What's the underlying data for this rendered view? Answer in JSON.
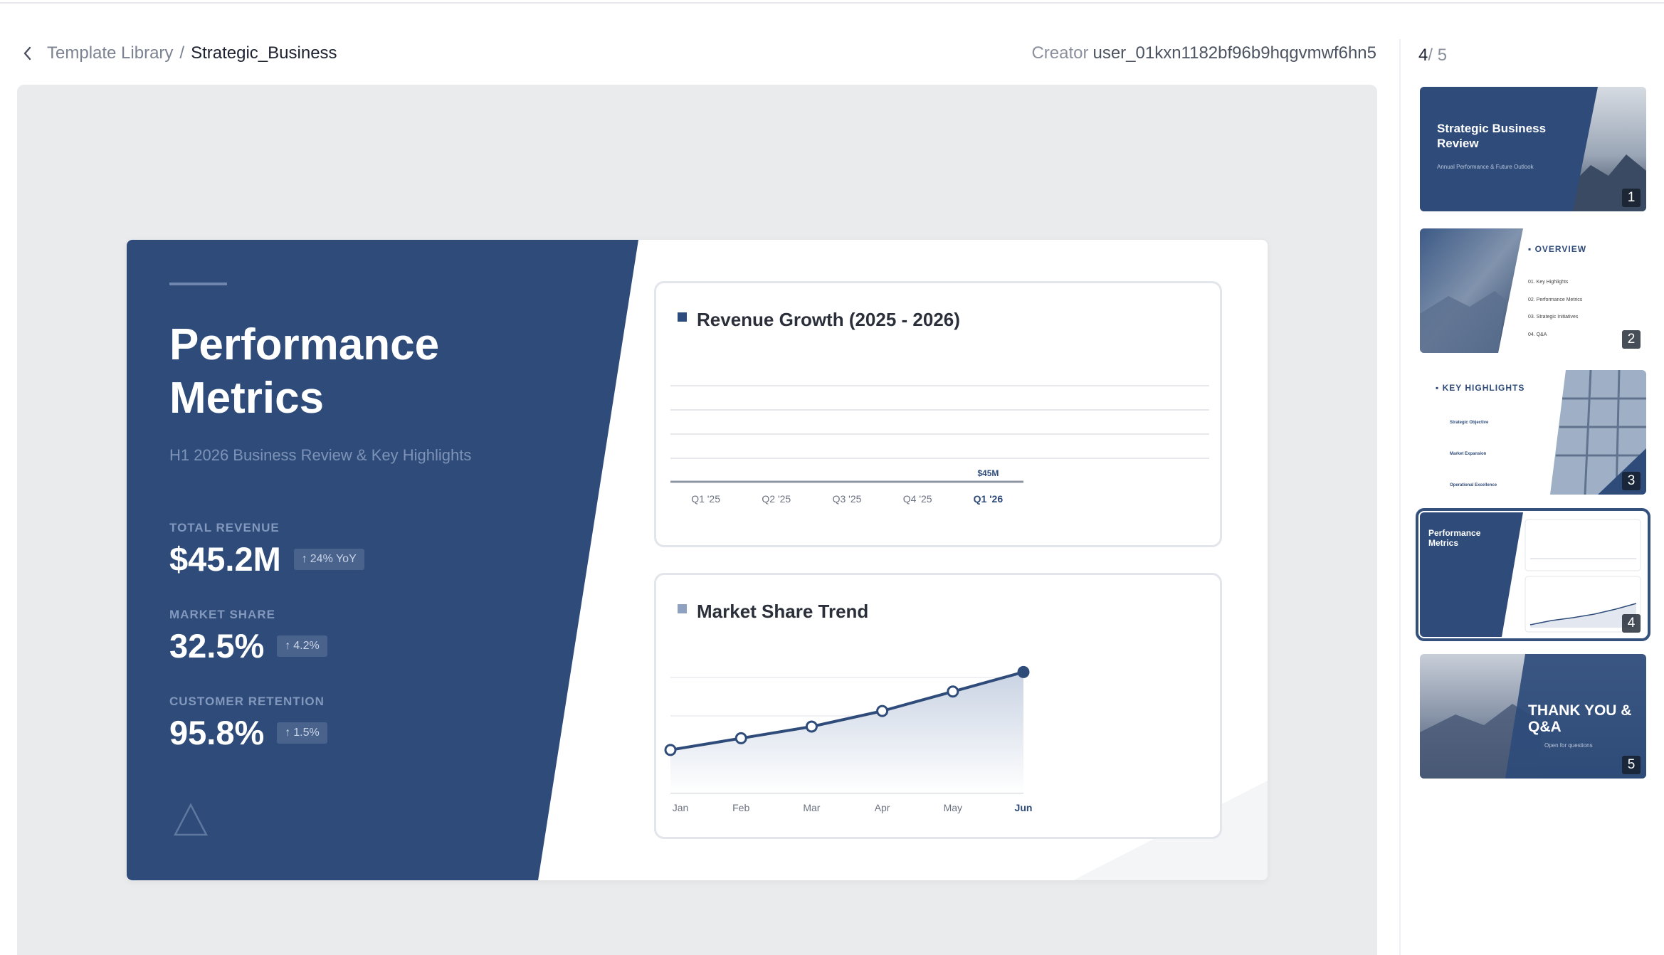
{
  "breadcrumb": {
    "parent": "Template Library",
    "separator": "/",
    "current": "Strategic_Business"
  },
  "creator": {
    "label": "Creator",
    "name": "user_01kxn1182bf96b9hqgvmwf6hn5"
  },
  "slide": {
    "title_line1": "Performance",
    "title_line2": "Metrics",
    "subtitle": "H1 2026 Business Review & Key Highlights",
    "metrics": [
      {
        "label": "TOTAL REVENUE",
        "value": "$45.2M",
        "badge": "24% YoY"
      },
      {
        "label": "MARKET SHARE",
        "value": "32.5%",
        "badge": "4.2%"
      },
      {
        "label": "CUSTOMER RETENTION",
        "value": "95.8%",
        "badge": "1.5%"
      }
    ]
  },
  "chart_data": [
    {
      "type": "bar",
      "title": "Revenue Growth (2025 - 2026)",
      "categories": [
        "Q1 '25",
        "Q2 '25",
        "Q3 '25",
        "Q4 '25",
        "Q1 '26"
      ],
      "values": [
        0,
        0,
        0,
        0,
        0
      ],
      "data_labels": [
        "",
        "",
        "",
        "",
        "$45M"
      ],
      "highlight": "Q1 '26",
      "grid": true
    },
    {
      "type": "area",
      "title": "Market Share Trend",
      "categories": [
        "Jan",
        "Feb",
        "Mar",
        "Apr",
        "May",
        "Jun"
      ],
      "values": [
        25.5,
        27.0,
        28.5,
        30.5,
        33.0,
        35.5
      ],
      "ylim": [
        20,
        37
      ],
      "highlight": "Jun",
      "grid": true
    }
  ],
  "sidebar": {
    "current": "4",
    "total": "/ 5",
    "thumbnails": [
      {
        "number": "1",
        "title": "Strategic Business Review",
        "subtitle": "Annual Performance & Future Outlook"
      },
      {
        "number": "2",
        "title": "OVERVIEW",
        "items": [
          "01. Key Highlights",
          "02. Performance Metrics",
          "03. Strategic Initiatives",
          "04. Q&A"
        ]
      },
      {
        "number": "3",
        "title": "KEY HIGHLIGHTS",
        "items": [
          "Strategic Objective",
          "Market Expansion",
          "Operational Excellence"
        ]
      },
      {
        "number": "4",
        "title": "Performance Metrics"
      },
      {
        "number": "5",
        "title": "THANK YOU & Q&A",
        "subtitle": "Open for questions"
      }
    ]
  },
  "colors": {
    "navy": "#2e4b7a",
    "accent": "#34507c",
    "grid": "#e6e8ec"
  }
}
